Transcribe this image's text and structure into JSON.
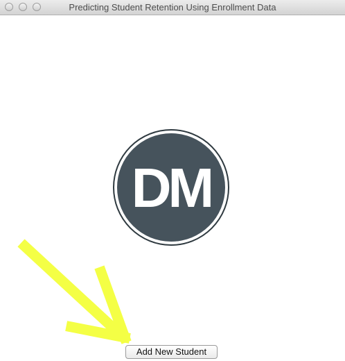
{
  "window": {
    "title": "Predicting Student Retention Using Enrollment Data"
  },
  "logo": {
    "text": "DM",
    "fill_color": "#46535c",
    "ring_color": "#2f3a40",
    "text_color": "#ffffff"
  },
  "annotation": {
    "arrow_color": "#f4ff45"
  },
  "main": {
    "add_student_label": "Add New Student"
  }
}
